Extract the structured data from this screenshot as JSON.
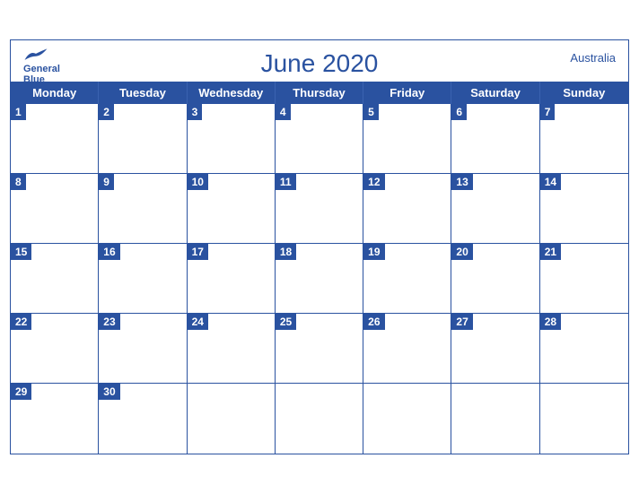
{
  "header": {
    "logo_line1": "General",
    "logo_line2": "Blue",
    "title": "June 2020",
    "country": "Australia"
  },
  "days_of_week": [
    "Monday",
    "Tuesday",
    "Wednesday",
    "Thursday",
    "Friday",
    "Saturday",
    "Sunday"
  ],
  "weeks": [
    [
      1,
      2,
      3,
      4,
      5,
      6,
      7
    ],
    [
      8,
      9,
      10,
      11,
      12,
      13,
      14
    ],
    [
      15,
      16,
      17,
      18,
      19,
      20,
      21
    ],
    [
      22,
      23,
      24,
      25,
      26,
      27,
      28
    ],
    [
      29,
      30,
      null,
      null,
      null,
      null,
      null
    ]
  ],
  "accent_color": "#2a52a0"
}
